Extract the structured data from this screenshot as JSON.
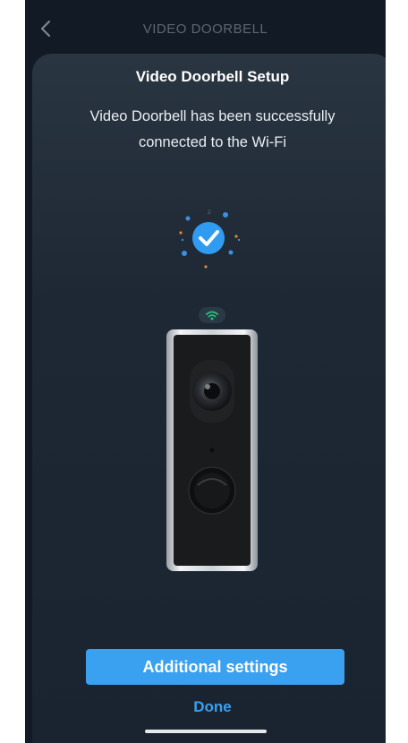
{
  "header": {
    "title": "VIDEO DOORBELL",
    "back_icon": "chevron-left-icon"
  },
  "card": {
    "title": "Video Doorbell Setup",
    "message": "Video Doorbell has been successfully connected to the Wi-Fi"
  },
  "status": {
    "icon": "check-circle-icon",
    "wifi_icon": "wifi-icon"
  },
  "device": {
    "image": "video-doorbell-image"
  },
  "actions": {
    "additional_settings_label": "Additional settings",
    "done_label": "Done"
  },
  "colors": {
    "accent": "#3aa0f0",
    "background": "#121b25",
    "card": "#1e2834",
    "wifi_green": "#27c37a"
  }
}
